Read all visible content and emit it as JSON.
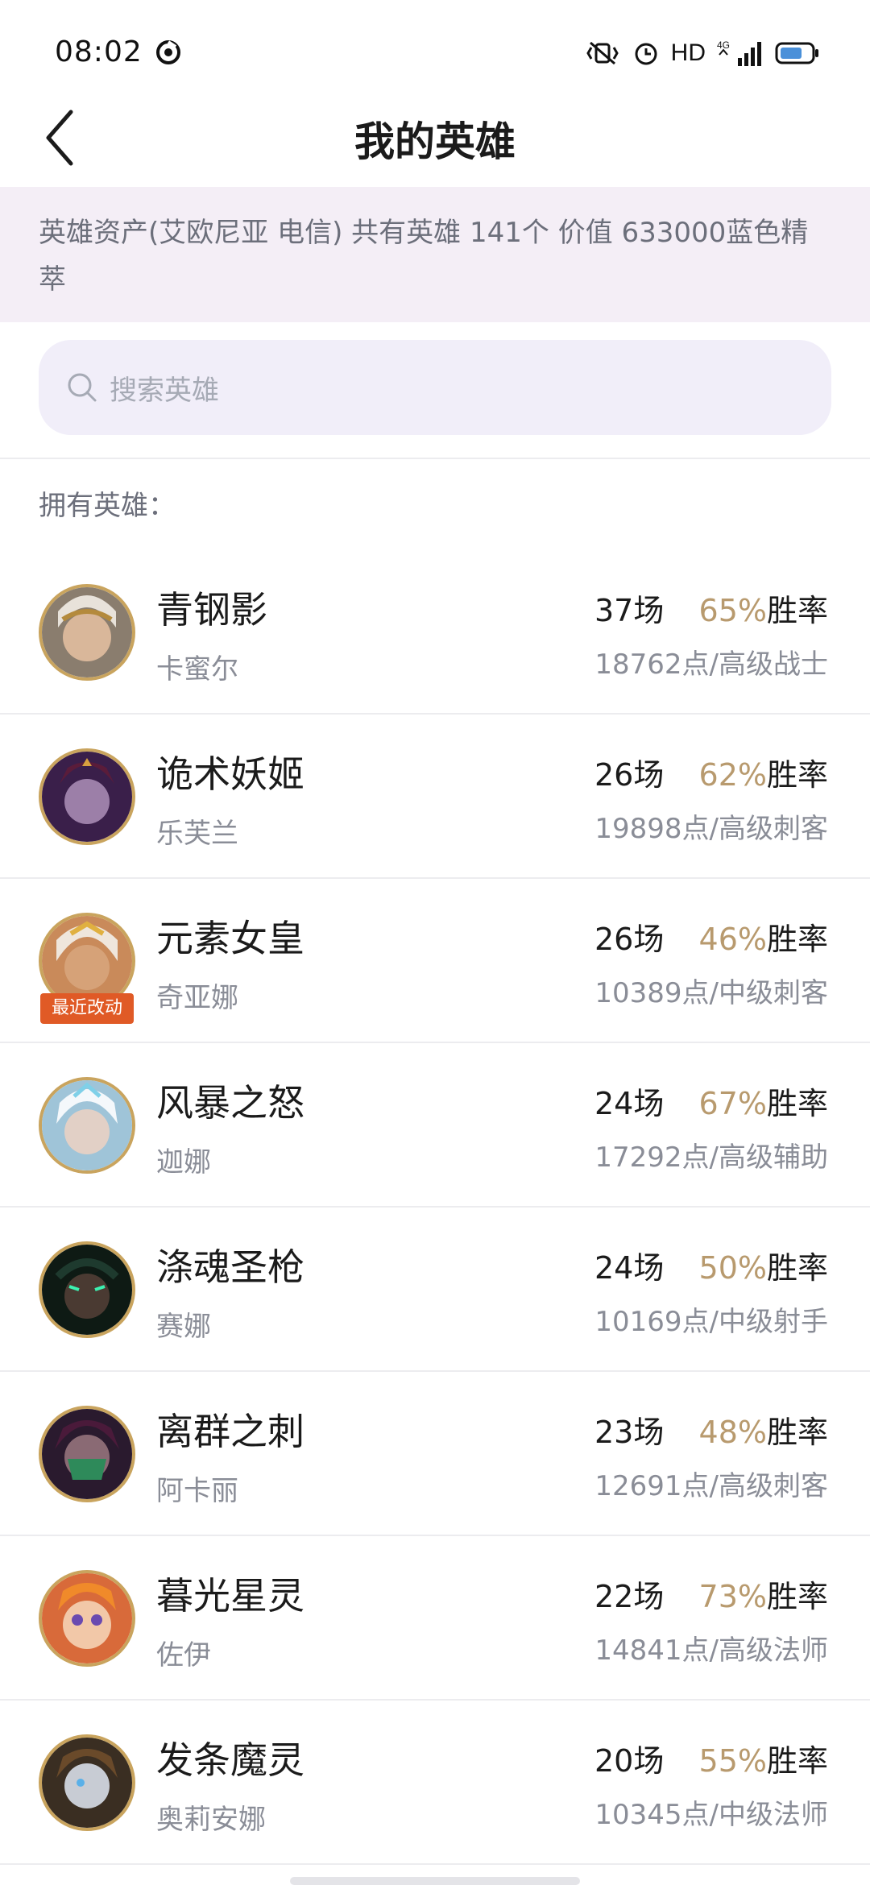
{
  "status_bar": {
    "time": "08:02",
    "hd_label": "HD",
    "network_label": "4G"
  },
  "header": {
    "title": "我的英雄",
    "back_icon": "chevron-left-icon"
  },
  "asset_info": {
    "text": "英雄资产(艾欧尼亚 电信)  共有英雄 141个  价值 633000蓝色精萃"
  },
  "search": {
    "placeholder": "搜索英雄"
  },
  "section": {
    "owned_label": "拥有英雄："
  },
  "heroes": [
    {
      "title": "青钢影",
      "name": "卡蜜尔",
      "games": "37场",
      "win_pct": "65%",
      "win_label": "胜率",
      "points": "18762点/高级战士",
      "badge": ""
    },
    {
      "title": "诡术妖姬",
      "name": "乐芙兰",
      "games": "26场",
      "win_pct": "62%",
      "win_label": "胜率",
      "points": "19898点/高级刺客",
      "badge": ""
    },
    {
      "title": "元素女皇",
      "name": "奇亚娜",
      "games": "26场",
      "win_pct": "46%",
      "win_label": "胜率",
      "points": "10389点/中级刺客",
      "badge": "最近改动"
    },
    {
      "title": "风暴之怒",
      "name": "迦娜",
      "games": "24场",
      "win_pct": "67%",
      "win_label": "胜率",
      "points": "17292点/高级辅助",
      "badge": ""
    },
    {
      "title": "涤魂圣枪",
      "name": "赛娜",
      "games": "24场",
      "win_pct": "50%",
      "win_label": "胜率",
      "points": "10169点/中级射手",
      "badge": ""
    },
    {
      "title": "离群之刺",
      "name": "阿卡丽",
      "games": "23场",
      "win_pct": "48%",
      "win_label": "胜率",
      "points": "12691点/高级刺客",
      "badge": ""
    },
    {
      "title": "暮光星灵",
      "name": "佐伊",
      "games": "22场",
      "win_pct": "73%",
      "win_label": "胜率",
      "points": "14841点/高级法师",
      "badge": ""
    },
    {
      "title": "发条魔灵",
      "name": "奥莉安娜",
      "games": "20场",
      "win_pct": "55%",
      "win_label": "胜率",
      "points": "10345点/中级法师",
      "badge": ""
    }
  ],
  "colors": {
    "accent_gold": "#b89a6e",
    "banner_bg": "#f4eef6",
    "search_bg": "#f1eef9",
    "badge_orange": "#e05a26"
  }
}
